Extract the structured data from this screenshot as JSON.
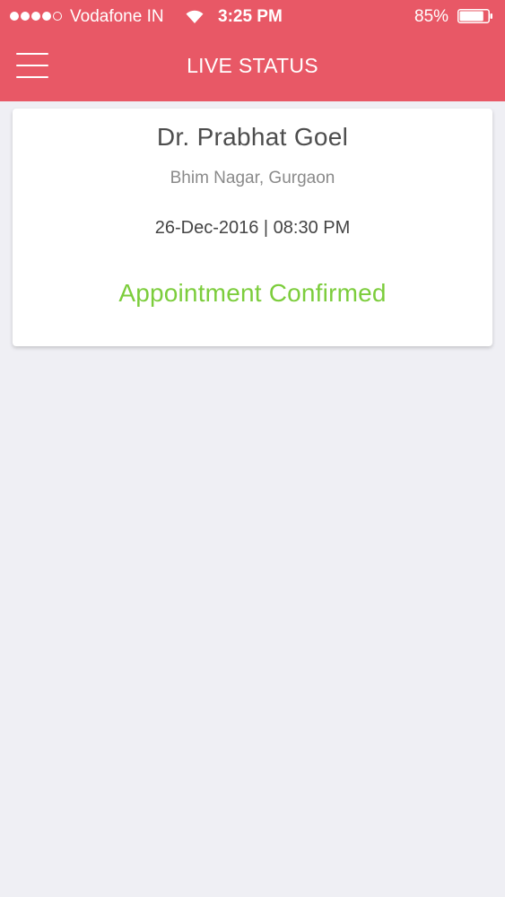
{
  "status_bar": {
    "carrier": "Vodafone IN",
    "time": "3:25 PM",
    "battery_percent": "85%",
    "battery_level": 0.85,
    "signal_bars": 4,
    "signal_total": 5,
    "icons": [
      "signal-dots-icon",
      "wifi-icon",
      "battery-icon"
    ]
  },
  "header": {
    "title": "LIVE STATUS",
    "menu_icon": "hamburger-menu-icon",
    "color": "#e85866"
  },
  "appointment": {
    "doctor": "Dr. Prabhat Goel",
    "location": "Bhim Nagar, Gurgaon",
    "datetime": "26-Dec-2016 | 08:30 PM",
    "status": "Appointment Confirmed",
    "status_color": "#7ccd3c"
  }
}
